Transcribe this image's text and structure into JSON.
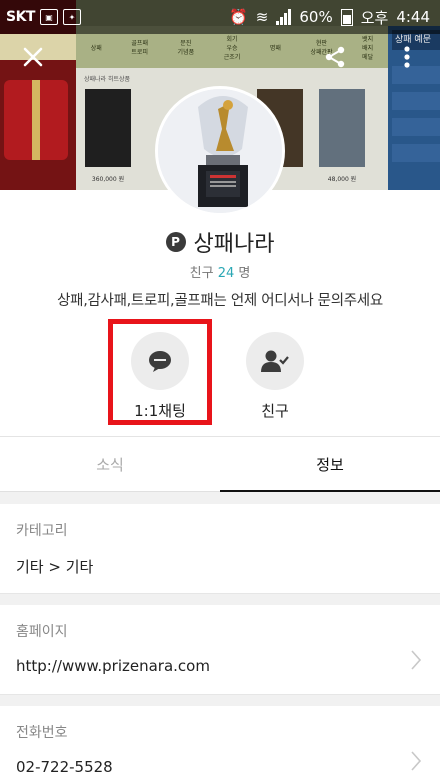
{
  "status_bar": {
    "carrier": "SKT",
    "battery": "60%",
    "ampm": "오후",
    "time": "4:44"
  },
  "banner": {
    "menu": [
      "상패",
      "골프패\n트로피",
      "문진\n기념품",
      "회기\n우승\n근조기",
      "명패",
      "현판\n상패간판",
      "뱃지\n배지\n메달"
    ],
    "section_title": "상패나라 히트상품",
    "prices": [
      "360,000 원",
      "",
      "",
      "48,000 원"
    ],
    "right_tag": "상패 예문"
  },
  "profile": {
    "badge": "P",
    "name": "상패나라",
    "friends_label": "친구",
    "friends_count": "24",
    "friends_unit": "명",
    "description": "상패,감사패,트로피,골프패는 언제 어디서나 문의주세요"
  },
  "actions": [
    {
      "label": "1:1채팅",
      "icon": "chat-bubble-icon"
    },
    {
      "label": "친구",
      "icon": "add-friend-icon"
    }
  ],
  "tabs": [
    {
      "label": "소식",
      "active": false
    },
    {
      "label": "정보",
      "active": true
    }
  ],
  "info": [
    {
      "key": "카테고리",
      "value": "기타 > 기타",
      "link": false
    },
    {
      "key": "홈페이지",
      "value": "http://www.prizenara.com",
      "link": true
    },
    {
      "key": "전화번호",
      "value": "02-722-5528",
      "link": true
    }
  ],
  "colors": {
    "highlight": "#e8141a",
    "accent": "#2aa7b4"
  }
}
